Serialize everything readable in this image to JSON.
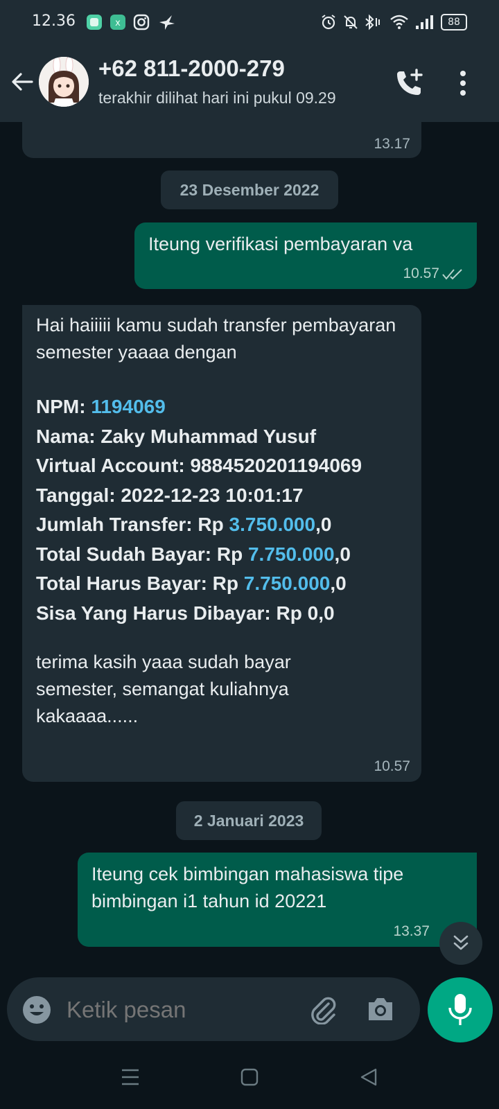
{
  "status_bar": {
    "time": "12.36",
    "battery": "88",
    "icons": [
      "app-icon-1",
      "app-icon-2",
      "instagram-icon",
      "bird-icon",
      "alarm-icon",
      "mute-icon",
      "bluetooth-icon",
      "wifi-icon",
      "signal-icon",
      "battery-icon"
    ]
  },
  "header": {
    "contact": "+62 811-2000-279",
    "last_seen": "terakhir dilihat hari ini pukul 09.29"
  },
  "messages": {
    "prev_time": "13.17",
    "date1": "23 Desember 2022",
    "out1": {
      "text": "Iteung verifikasi pembayaran va",
      "time": "10.57"
    },
    "in1": {
      "intro": "Hai haiiiii kamu sudah transfer pembayaran semester yaaaa dengan",
      "npm_label": "NPM: ",
      "npm_value": "1194069",
      "nama": "Nama: Zaky Muhammad Yusuf",
      "va": "Virtual Account: 9884520201194069",
      "tanggal": "Tanggal: 2022-12-23 10:01:17",
      "jumlah_label": "Jumlah Transfer: Rp ",
      "jumlah_value": "3.750.000",
      "jumlah_suffix": ",0",
      "sudah_label": "Total Sudah Bayar: Rp ",
      "sudah_value": "7.750.000",
      "sudah_suffix": ",0",
      "harus_label": "Total Harus Bayar: Rp ",
      "harus_value": "7.750.000",
      "harus_suffix": ",0",
      "sisa": "Sisa Yang Harus Dibayar: Rp 0,0",
      "outro": "terima kasih yaaa sudah bayar semester, semangat kuliahnya kakaaaa......",
      "time": "10.57"
    },
    "date2": "2 Januari 2023",
    "out2": {
      "text": "Iteung cek bimbingan mahasiswa tipe bimbingan i1 tahun id 20221",
      "time": "13.37"
    }
  },
  "input": {
    "placeholder": "Ketik pesan"
  },
  "colors": {
    "outgoing": "#005c4b",
    "incoming": "#1f2c34",
    "accent": "#00a884",
    "link": "#53bdeb"
  }
}
